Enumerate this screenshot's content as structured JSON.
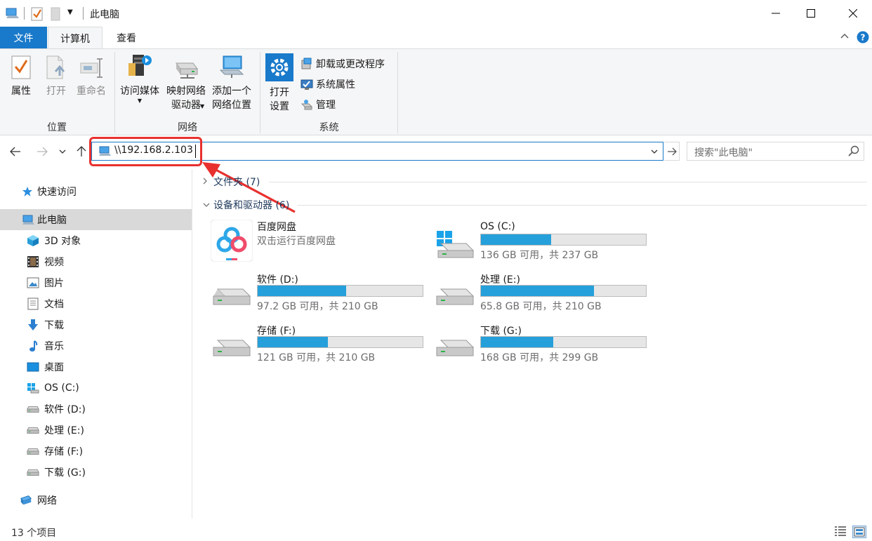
{
  "window": {
    "title": "此电脑",
    "minimize_glyph": "—",
    "maximize_glyph": "☐",
    "close_glyph": "✕"
  },
  "ribbon_tabs": {
    "file": "文件",
    "computer": "计算机",
    "view": "查看"
  },
  "ribbon": {
    "location": {
      "label": "位置",
      "properties": "属性",
      "open": "打开",
      "rename": "重命名"
    },
    "network": {
      "label": "网络",
      "access_media_1": "访问媒体",
      "map_drive_1": "映射网络",
      "map_drive_2": "驱动器",
      "add_location_1": "添加一个",
      "add_location_2": "网络位置"
    },
    "system": {
      "label": "系统",
      "open_settings_1": "打开",
      "open_settings_2": "设置",
      "uninstall": "卸载或更改程序",
      "system_properties": "系统属性",
      "manage": "管理"
    }
  },
  "address": {
    "value": "\\\\192.168.2.103",
    "search_placeholder": "搜索\"此电脑\""
  },
  "nav": {
    "quick_access": "快速访问",
    "this_pc": "此电脑",
    "objects_3d": "3D 对象",
    "videos": "视频",
    "pictures": "图片",
    "documents": "文档",
    "downloads": "下载",
    "music": "音乐",
    "desktop": "桌面",
    "drive_c": "OS (C:)",
    "drive_d": "软件 (D:)",
    "drive_e": "处理 (E:)",
    "drive_f": "存储 (F:)",
    "drive_g": "下载 (G:)",
    "network": "网络"
  },
  "content": {
    "folders_header": "文件夹 (7)",
    "devices_header": "设备和驱动器 (6)",
    "baidu": {
      "name": "百度网盘",
      "sub": "双击运行百度网盘"
    },
    "drives": [
      {
        "name": "OS (C:)",
        "free": "136 GB 可用，共 237 GB",
        "used_fraction": 0.426
      },
      {
        "name": "软件 (D:)",
        "free": "97.2 GB 可用，共 210 GB",
        "used_fraction": 0.537
      },
      {
        "name": "处理 (E:)",
        "free": "65.8 GB 可用，共 210 GB",
        "used_fraction": 0.687
      },
      {
        "name": "存储 (F:)",
        "free": "121 GB 可用，共 210 GB",
        "used_fraction": 0.424
      },
      {
        "name": "下载 (G:)",
        "free": "168 GB 可用，共 299 GB",
        "used_fraction": 0.438
      }
    ]
  },
  "status": {
    "count": "13 个项目"
  },
  "colors": {
    "accent": "#1979ca",
    "bar_fill": "#26a0da",
    "annotation": "#e8312f"
  }
}
